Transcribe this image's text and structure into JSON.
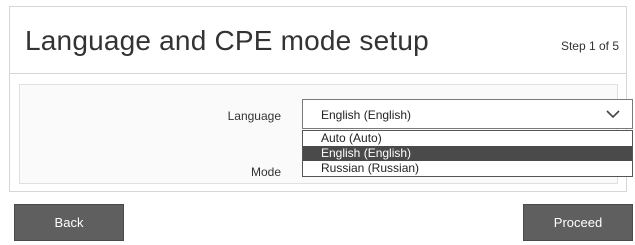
{
  "header": {
    "title": "Language and CPE mode setup",
    "step": "Step 1 of 5"
  },
  "form": {
    "language_label": "Language",
    "mode_label": "Mode",
    "language_select": {
      "value": "English (English)",
      "icon": "chevron-down-icon",
      "options": [
        {
          "label": "Auto (Auto)",
          "selected": false
        },
        {
          "label": "English (English)",
          "selected": true
        },
        {
          "label": "Russian (Russian)",
          "selected": false
        }
      ]
    }
  },
  "footer": {
    "back_label": "Back",
    "proceed_label": "Proceed"
  },
  "colors": {
    "button_bg": "#5f5f5f",
    "selected_option_bg": "#4a4a4a",
    "border": "#d6d6d6"
  }
}
